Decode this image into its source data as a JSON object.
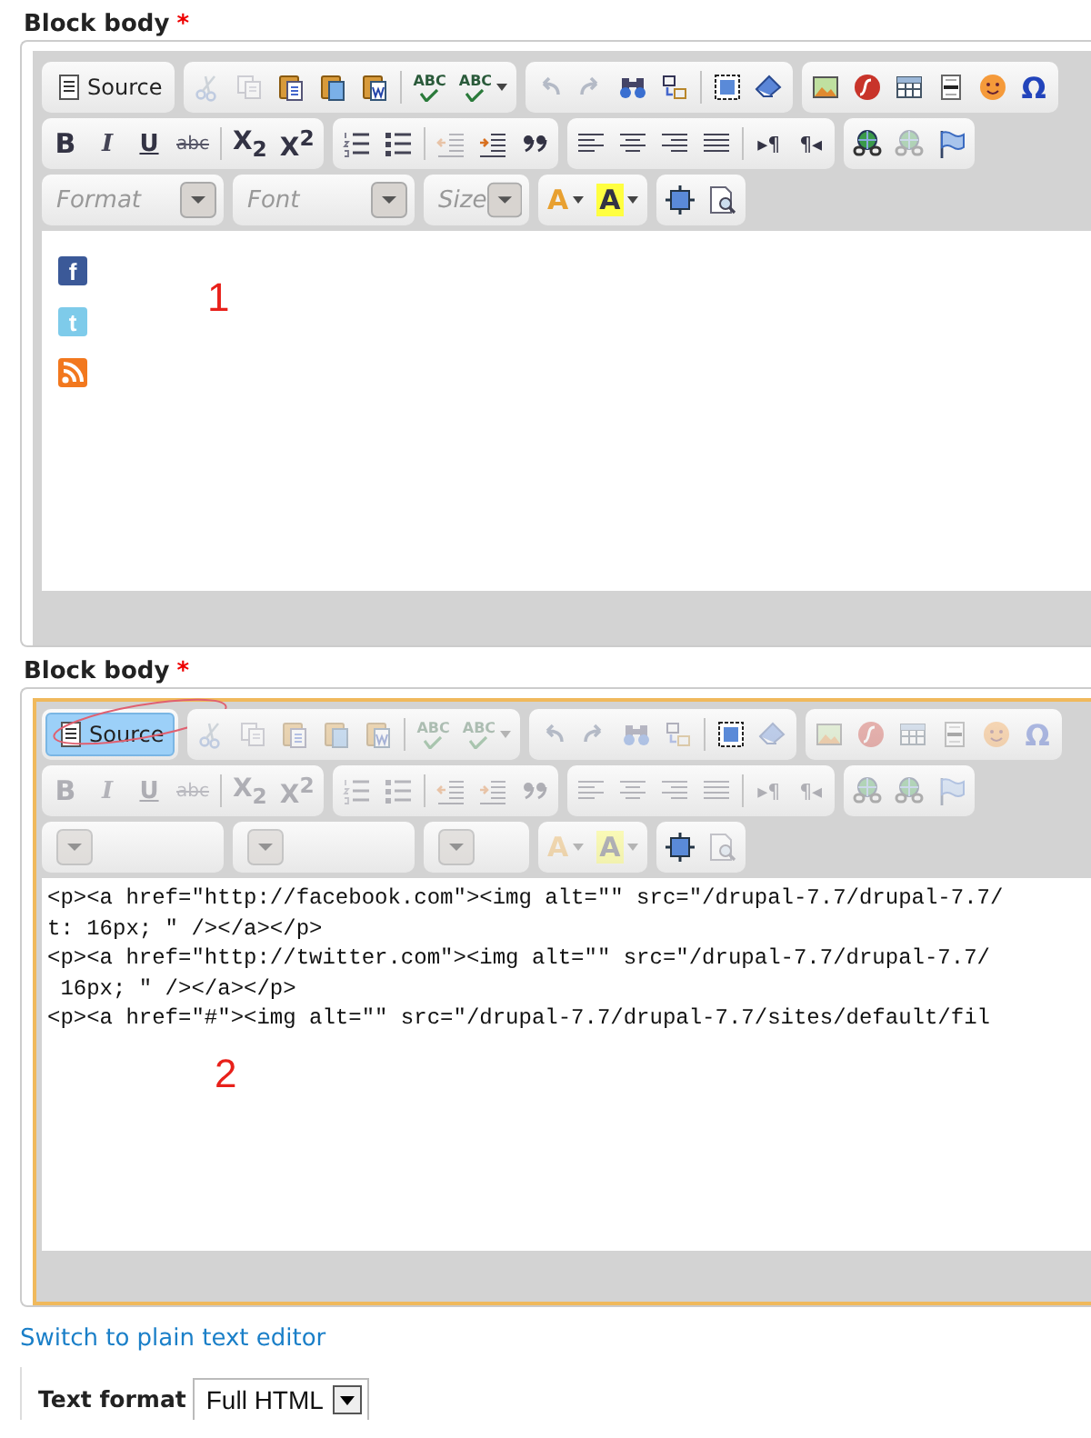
{
  "editors": [
    {
      "label": "Block body",
      "required_mark": "*",
      "annotation": "1",
      "toolbar": [
        [
          [
            {
              "kind": "source",
              "label": "Source",
              "selected": false,
              "circled": false
            }
          ],
          [
            {
              "kind": "cut",
              "disabled": true
            },
            {
              "kind": "copy",
              "disabled": true
            },
            {
              "kind": "paste",
              "disabled": false
            },
            {
              "kind": "paste-text",
              "disabled": false
            },
            {
              "kind": "paste-word",
              "disabled": false
            },
            {
              "kind": "separator"
            },
            {
              "kind": "spellcheck",
              "label": "ABC",
              "disabled": false
            },
            {
              "kind": "spellcheck-menu",
              "label": "ABC",
              "disabled": false
            }
          ],
          [
            {
              "kind": "undo",
              "disabled": true
            },
            {
              "kind": "redo",
              "disabled": true
            },
            {
              "kind": "find",
              "disabled": false
            },
            {
              "kind": "replace",
              "disabled": false
            },
            {
              "kind": "separator"
            },
            {
              "kind": "select-all",
              "disabled": false
            },
            {
              "kind": "eraser",
              "disabled": false
            }
          ],
          [
            {
              "kind": "image",
              "disabled": false
            },
            {
              "kind": "flash",
              "disabled": false
            },
            {
              "kind": "table",
              "disabled": false
            },
            {
              "kind": "hr",
              "disabled": false
            },
            {
              "kind": "smiley",
              "disabled": false
            },
            {
              "kind": "char",
              "label": "Ω",
              "disabled": false
            }
          ]
        ],
        [
          [
            {
              "kind": "bold",
              "label": "B",
              "disabled": false
            },
            {
              "kind": "italic",
              "label": "I",
              "disabled": false
            },
            {
              "kind": "underline",
              "label": "U",
              "disabled": false
            },
            {
              "kind": "strike",
              "label": "abc",
              "disabled": false
            },
            {
              "kind": "separator"
            },
            {
              "kind": "script",
              "label": "X$_{2}$",
              "disabled": false
            },
            {
              "kind": "script",
              "label": "X$^{2}$",
              "disabled": false
            }
          ],
          [
            {
              "kind": "ol",
              "disabled": false
            },
            {
              "kind": "ul",
              "disabled": false
            },
            {
              "kind": "separator"
            },
            {
              "kind": "outdent",
              "disabled": true
            },
            {
              "kind": "indent",
              "disabled": false
            },
            {
              "kind": "blockquote",
              "disabled": false
            }
          ],
          [
            {
              "kind": "align-left",
              "disabled": false
            },
            {
              "kind": "align-center",
              "disabled": false
            },
            {
              "kind": "align-right",
              "disabled": false
            },
            {
              "kind": "align-justify",
              "disabled": false
            },
            {
              "kind": "separator"
            },
            {
              "kind": "direction",
              "label": "▸¶",
              "disabled": false
            },
            {
              "kind": "direction",
              "label": "¶◂",
              "disabled": false
            }
          ],
          [
            {
              "kind": "link",
              "disabled": false
            },
            {
              "kind": "unlink",
              "disabled": true
            },
            {
              "kind": "anchor",
              "disabled": false
            }
          ]
        ],
        [
          [
            {
              "kind": "combo",
              "placeholder": "Format",
              "disabled": false
            }
          ],
          [
            {
              "kind": "combo",
              "placeholder": "Font",
              "disabled": false
            }
          ],
          [
            {
              "kind": "combo",
              "placeholder": "Size",
              "disabled": false
            }
          ],
          [
            {
              "kind": "text-color",
              "label": "A",
              "disabled": false
            },
            {
              "kind": "bg-color",
              "label": "A",
              "disabled": false
            }
          ],
          [
            {
              "kind": "maximize",
              "disabled": false
            },
            {
              "kind": "show-blocks",
              "disabled": false
            }
          ]
        ]
      ],
      "content": {
        "icons": [
          {
            "kind": "facebook",
            "label": "f"
          },
          {
            "kind": "twitter",
            "label": "t"
          },
          {
            "kind": "rss"
          }
        ]
      }
    },
    {
      "label": "Block body",
      "required_mark": "*",
      "annotation": "2",
      "toolbar": [
        [
          [
            {
              "kind": "source",
              "label": "Source",
              "selected": true,
              "circled": true
            }
          ],
          [
            {
              "kind": "cut",
              "disabled": true
            },
            {
              "kind": "copy",
              "disabled": true
            },
            {
              "kind": "paste",
              "disabled": true
            },
            {
              "kind": "paste-text",
              "disabled": true
            },
            {
              "kind": "paste-word",
              "disabled": true
            },
            {
              "kind": "separator"
            },
            {
              "kind": "spellcheck",
              "label": "ABC",
              "disabled": true
            },
            {
              "kind": "spellcheck-menu",
              "label": "ABC",
              "disabled": true
            }
          ],
          [
            {
              "kind": "undo",
              "disabled": true
            },
            {
              "kind": "redo",
              "disabled": true
            },
            {
              "kind": "find",
              "disabled": true
            },
            {
              "kind": "replace",
              "disabled": true
            },
            {
              "kind": "separator"
            },
            {
              "kind": "select-all",
              "disabled": false
            },
            {
              "kind": "eraser",
              "disabled": true
            }
          ],
          [
            {
              "kind": "image",
              "disabled": true
            },
            {
              "kind": "flash",
              "disabled": true
            },
            {
              "kind": "table",
              "disabled": true
            },
            {
              "kind": "hr",
              "disabled": true
            },
            {
              "kind": "smiley",
              "disabled": true
            },
            {
              "kind": "char",
              "label": "Ω",
              "disabled": true
            }
          ]
        ],
        [
          [
            {
              "kind": "bold",
              "label": "B",
              "disabled": true
            },
            {
              "kind": "italic",
              "label": "I",
              "disabled": true
            },
            {
              "kind": "underline",
              "label": "U",
              "disabled": true
            },
            {
              "kind": "strike",
              "label": "abc",
              "disabled": true
            },
            {
              "kind": "separator"
            },
            {
              "kind": "script",
              "label": "X$_{2}$",
              "disabled": true
            },
            {
              "kind": "script",
              "label": "X$^{2}$",
              "disabled": true
            }
          ],
          [
            {
              "kind": "ol",
              "disabled": true
            },
            {
              "kind": "ul",
              "disabled": true
            },
            {
              "kind": "separator"
            },
            {
              "kind": "outdent",
              "disabled": true
            },
            {
              "kind": "indent",
              "disabled": true
            },
            {
              "kind": "blockquote",
              "disabled": true
            }
          ],
          [
            {
              "kind": "align-left",
              "disabled": true
            },
            {
              "kind": "align-center",
              "disabled": true
            },
            {
              "kind": "align-right",
              "disabled": true
            },
            {
              "kind": "align-justify",
              "disabled": true
            },
            {
              "kind": "separator"
            },
            {
              "kind": "direction",
              "label": "▸¶",
              "disabled": true
            },
            {
              "kind": "direction",
              "label": "¶◂",
              "disabled": true
            }
          ],
          [
            {
              "kind": "link",
              "disabled": true
            },
            {
              "kind": "unlink",
              "disabled": true
            },
            {
              "kind": "anchor",
              "disabled": true
            }
          ]
        ],
        [
          [
            {
              "kind": "combo",
              "disabled": true
            }
          ],
          [
            {
              "kind": "combo",
              "disabled": true
            }
          ],
          [
            {
              "kind": "combo",
              "disabled": true
            }
          ],
          [
            {
              "kind": "text-color",
              "label": "A",
              "disabled": true
            },
            {
              "kind": "bg-color",
              "label": "A",
              "disabled": true
            }
          ],
          [
            {
              "kind": "maximize",
              "disabled": false
            },
            {
              "kind": "show-blocks",
              "disabled": true
            }
          ]
        ]
      ],
      "content": {
        "code_lines": [
          "<p><a href=\"http://facebook.com\"><img alt=\"\" src=\"/drupal-7.7/drupal-7.7/",
          "t: 16px; \" /></a></p>",
          "<p><a href=\"http://twitter.com\"><img alt=\"\" src=\"/drupal-7.7/drupal-7.7/",
          " 16px; \" /></a></p>",
          "<p><a href=\"#\"><img alt=\"\" src=\"/drupal-7.7/drupal-7.7/sites/default/fil"
        ]
      }
    }
  ],
  "switch_link": "Switch to plain text editor",
  "text_format": {
    "label": "Text format",
    "value": "Full HTML"
  }
}
